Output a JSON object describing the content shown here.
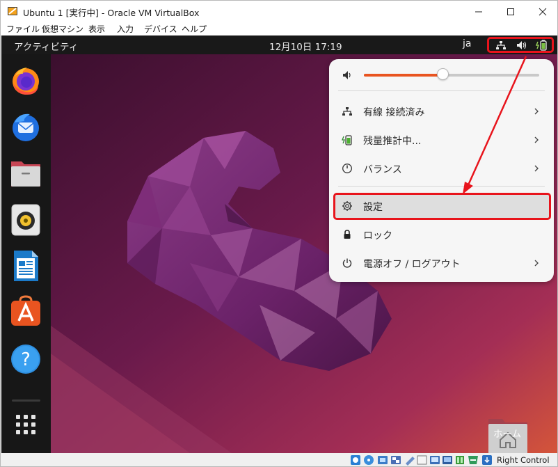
{
  "window": {
    "title": "Ubuntu 1 [実行中] - Oracle VM VirtualBox",
    "controls": [
      "minimize",
      "maximize",
      "close"
    ]
  },
  "menubar": {
    "items": [
      "ファイル",
      "仮想マシン",
      "表示",
      "入力",
      "デバイス",
      "ヘルプ"
    ]
  },
  "topbar": {
    "activities": "アクティビティ",
    "clock": "12月10日  17:19",
    "lang": "ja",
    "tray_icons": [
      "network-icon",
      "volume-icon",
      "battery-icon"
    ]
  },
  "dock": {
    "items": [
      "firefox",
      "thunderbird",
      "files",
      "rhythmbox",
      "libreoffice-writer",
      "app-center",
      "help",
      "show-apps"
    ]
  },
  "quick_menu": {
    "volume_level": 0.45,
    "items": [
      {
        "label": "有線 接続済み",
        "icon": "network-wired-icon",
        "submenu": true
      },
      {
        "label": "残量推計中...",
        "icon": "battery-charging-icon",
        "submenu": true
      },
      {
        "label": "バランス",
        "icon": "power-profile-icon",
        "submenu": true
      },
      {
        "label": "設定",
        "icon": "settings-gear-icon",
        "submenu": false
      },
      {
        "label": "ロック",
        "icon": "lock-icon",
        "submenu": false
      },
      {
        "label": "電源オフ / ログアウト",
        "icon": "power-icon",
        "submenu": true
      }
    ]
  },
  "desktop": {
    "home_label": "ホーム"
  },
  "statusbar": {
    "host_key": "Right Control"
  },
  "colors": {
    "accent": "#e95420",
    "highlight": "#e8141c",
    "topbar": "#191919",
    "dock": "#171717"
  }
}
